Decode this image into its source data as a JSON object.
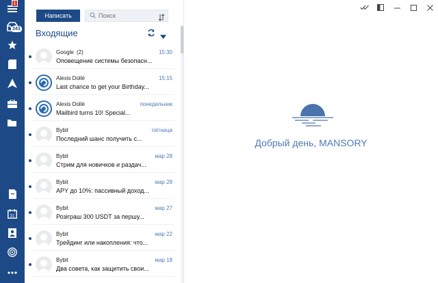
{
  "rail": {
    "notification_badge": "1",
    "inbox_count": "343",
    "items": [
      {
        "icon": "menu-icon"
      },
      {
        "icon": "inbox-icon"
      },
      {
        "icon": "star-icon"
      },
      {
        "icon": "drafts-icon"
      },
      {
        "icon": "sent-icon"
      },
      {
        "icon": "archive-icon"
      },
      {
        "icon": "folder-icon"
      },
      {
        "icon": "notes-icon"
      },
      {
        "icon": "calendar-icon"
      },
      {
        "icon": "contacts-icon"
      },
      {
        "icon": "fingerprint-icon"
      },
      {
        "icon": "more-icon"
      }
    ],
    "calendar_day": "31"
  },
  "toolbar": {
    "compose_label": "Написать",
    "search_placeholder": "Поиск"
  },
  "folder": {
    "title": "Входящие"
  },
  "messages": [
    {
      "sender": "Google",
      "count": "(2)",
      "time": "15:30",
      "subject": "Оповещение системы безопасн...",
      "avatar": "default"
    },
    {
      "sender": "Alexis Dollé",
      "count": "",
      "time": "15:15",
      "subject": "Last chance to get your Birthday...",
      "avatar": "ext"
    },
    {
      "sender": "Alexis Dollé",
      "count": "",
      "time": "понедельник",
      "subject": "Mailbird turns 10! Special...",
      "avatar": "ext"
    },
    {
      "sender": "Bybit",
      "count": "",
      "time": "пятница",
      "subject": "Последний шанс получить с...",
      "avatar": "default"
    },
    {
      "sender": "Bybit",
      "count": "",
      "time": "мар 28",
      "subject": "Стрим для новичков и раздач...",
      "avatar": "default"
    },
    {
      "sender": "Bybit",
      "count": "",
      "time": "мар 28",
      "subject": "APY до 10%: пассивный доход...",
      "avatar": "default"
    },
    {
      "sender": "Bybit",
      "count": "",
      "time": "мар 27",
      "subject": "Розіграш 300 USDT за першу...",
      "avatar": "default"
    },
    {
      "sender": "Bybit",
      "count": "",
      "time": "мар 22",
      "subject": "Трейдинг или накопления: что...",
      "avatar": "default"
    },
    {
      "sender": "Bybit",
      "count": "",
      "time": "мар 18",
      "subject": "Два совета, как защитить свои...",
      "avatar": "default"
    }
  ],
  "pane": {
    "greeting": "Добрый день, MANSORY"
  },
  "colors": {
    "rail_bg": "#1d4a86",
    "accent": "#1d4a86",
    "time_text": "#4a7bb5",
    "badge_red": "#d93636"
  }
}
